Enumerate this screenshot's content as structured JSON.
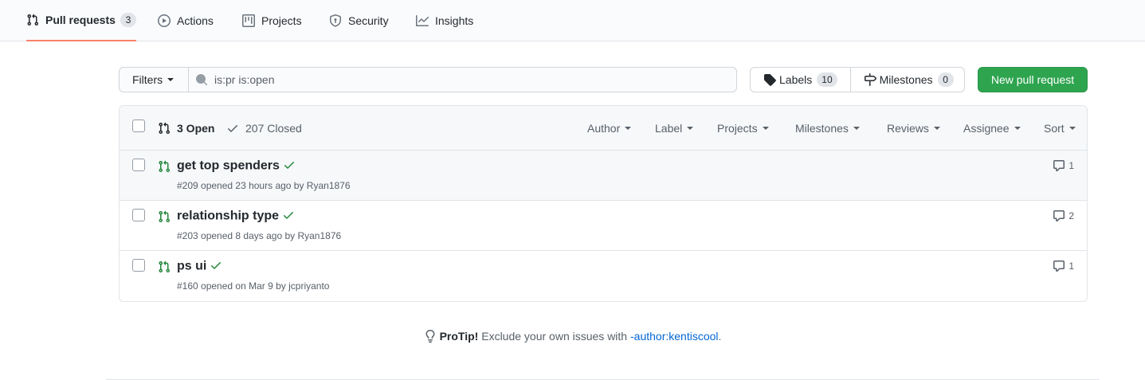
{
  "nav": {
    "tabs": [
      {
        "label": "Pull requests",
        "count": "3",
        "icon": "git-pull-request-icon",
        "active": true
      },
      {
        "label": "Actions",
        "icon": "play-icon"
      },
      {
        "label": "Projects",
        "icon": "project-icon"
      },
      {
        "label": "Security",
        "icon": "shield-icon"
      },
      {
        "label": "Insights",
        "icon": "graph-icon"
      }
    ]
  },
  "toolbar": {
    "filters_label": "Filters",
    "search_value": "is:pr is:open",
    "labels_label": "Labels",
    "labels_count": "10",
    "milestones_label": "Milestones",
    "milestones_count": "0",
    "new_pr_label": "New pull request"
  },
  "list_header": {
    "open_label": "3 Open",
    "closed_label": "207 Closed",
    "filters": [
      "Author",
      "Label",
      "Projects",
      "Milestones",
      "Reviews",
      "Assignee",
      "Sort"
    ]
  },
  "pull_requests": [
    {
      "title": "get top spenders",
      "meta": "#209 opened 23 hours ago by Ryan1876",
      "comments": "1",
      "status": "success"
    },
    {
      "title": "relationship type",
      "meta": "#203 opened 8 days ago by Ryan1876",
      "comments": "2",
      "status": "success"
    },
    {
      "title": "ps ui",
      "meta": "#160 opened on Mar 9 by jcpriyanto",
      "comments": "1",
      "status": "success"
    }
  ],
  "protip": {
    "label": "ProTip!",
    "text": "Exclude your own issues with",
    "link": "-author:kentiscool",
    "suffix": "."
  },
  "colors": {
    "accent_tab": "#f9826c",
    "primary_button": "#2ea44f",
    "open_icon": "#22863a",
    "link": "#0366d6"
  }
}
